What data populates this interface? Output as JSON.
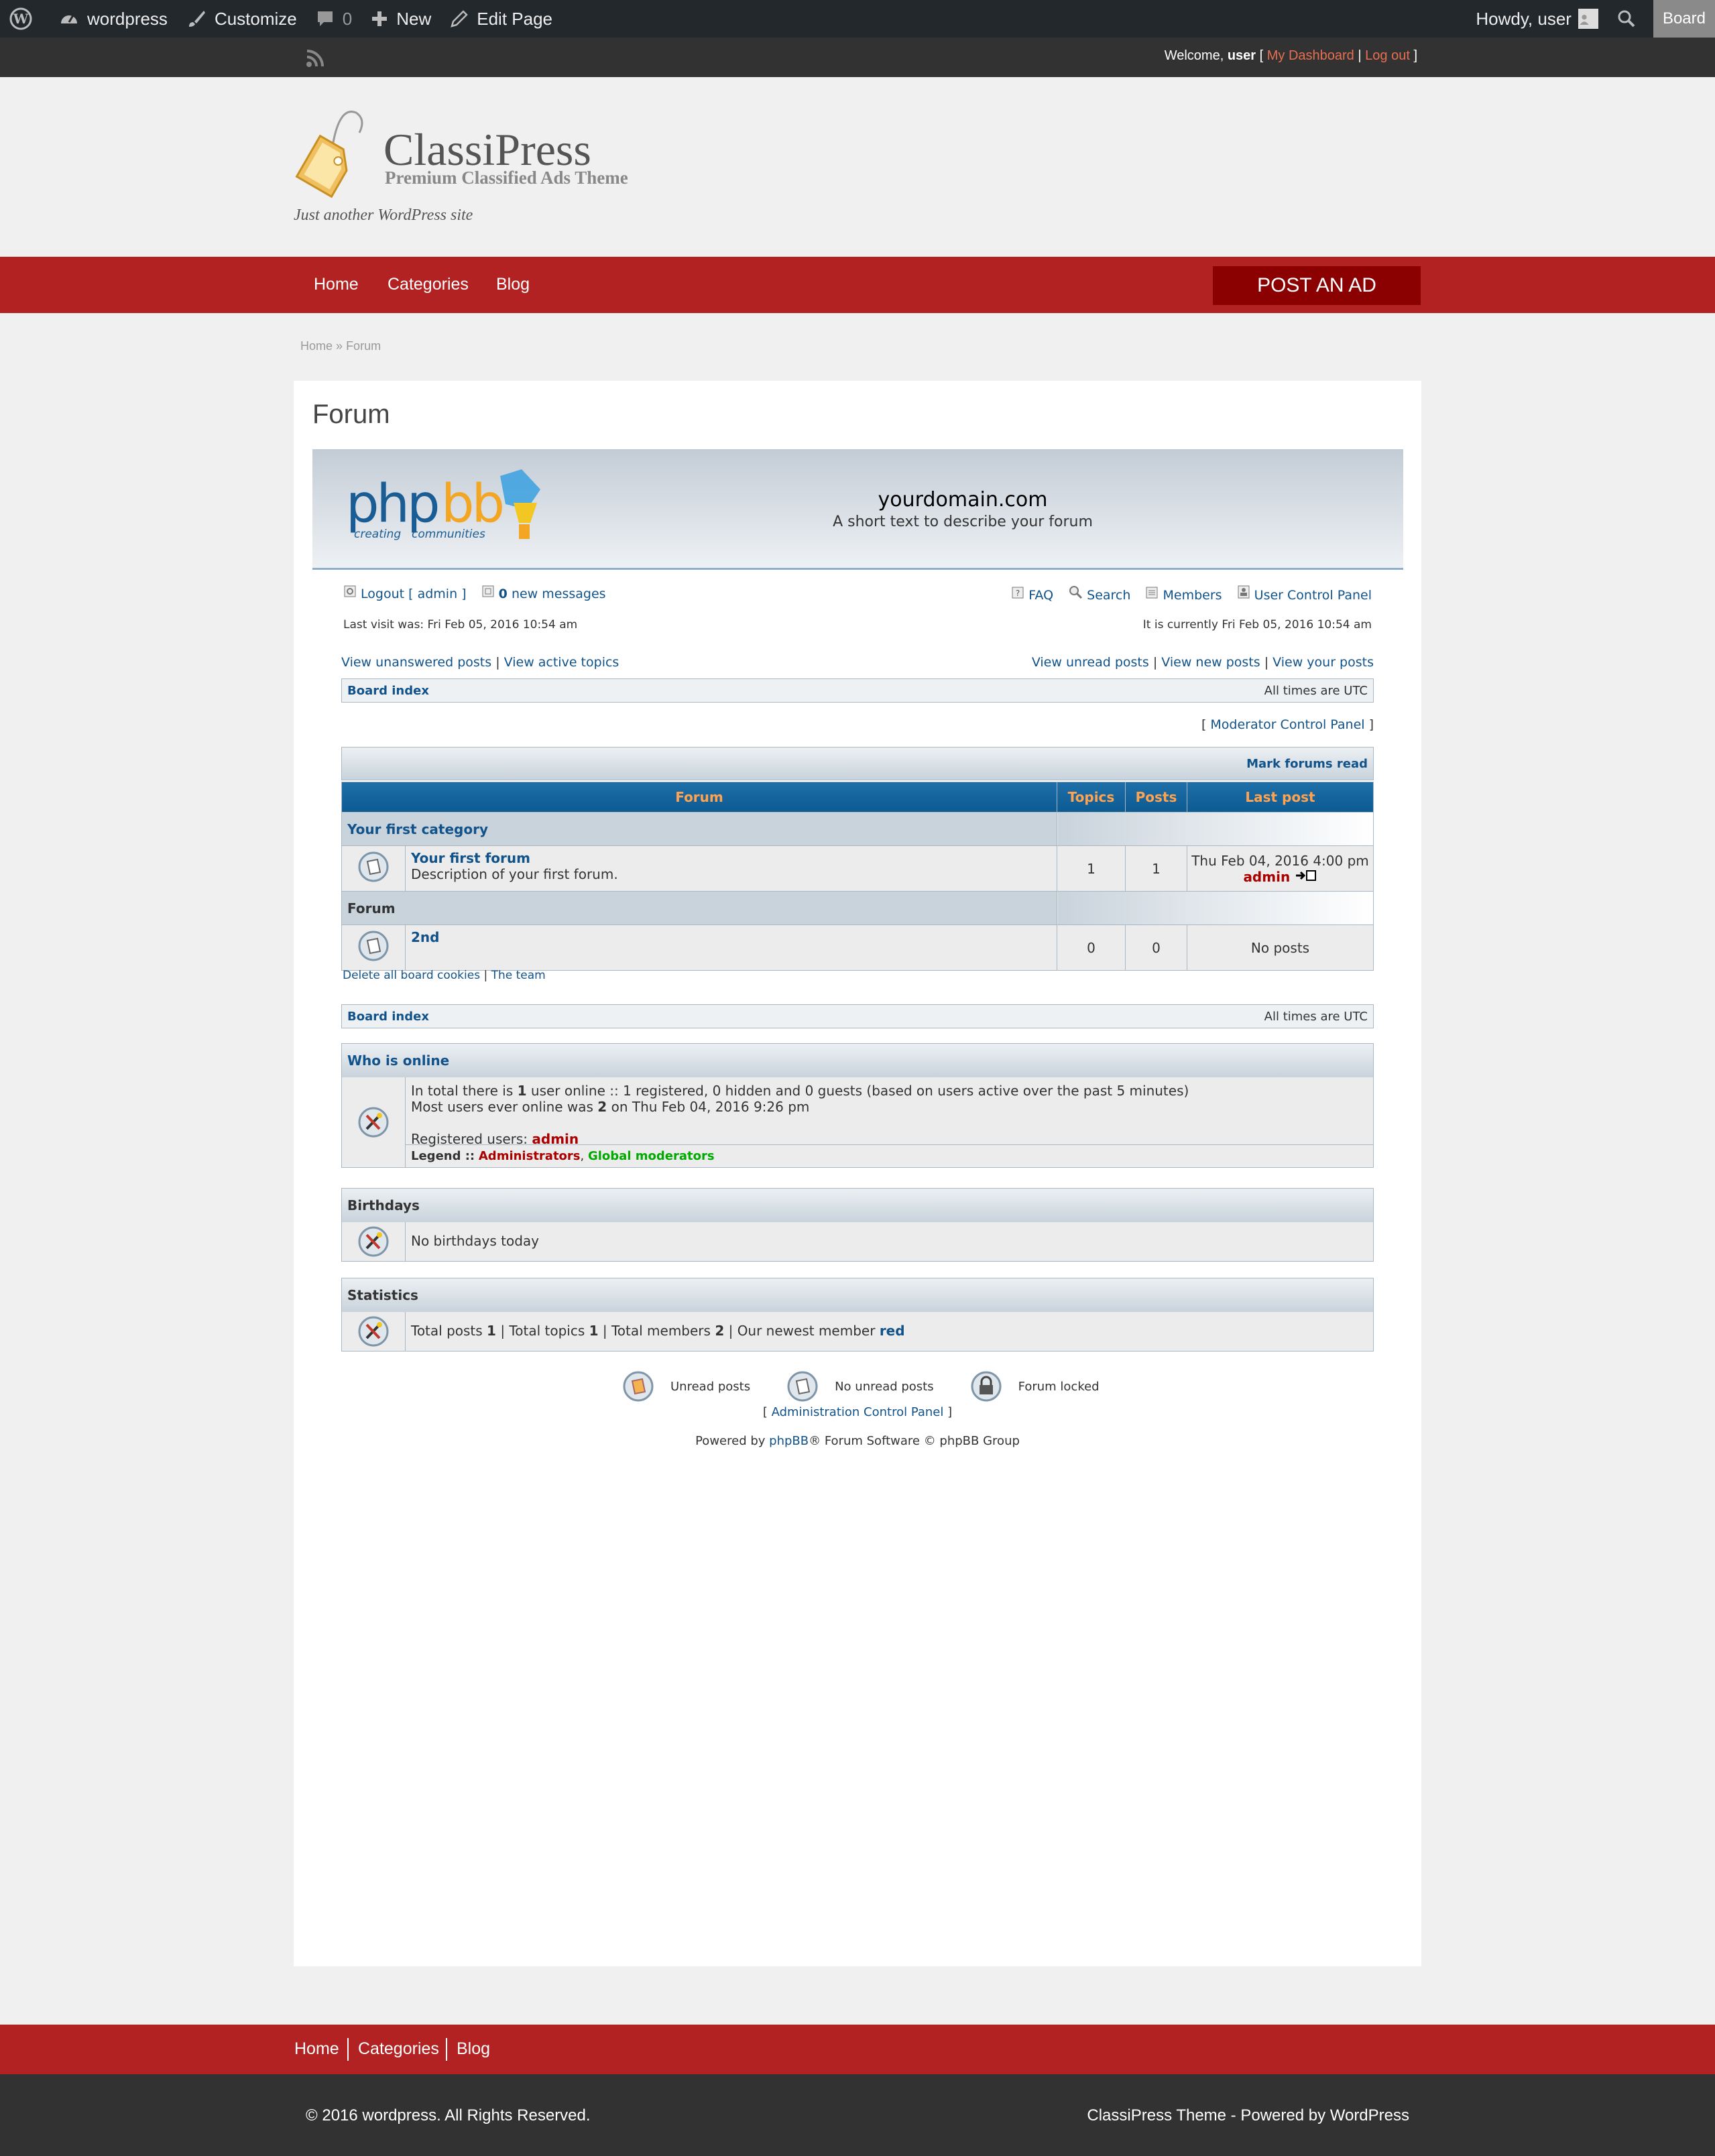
{
  "adminbar": {
    "site": "wordpress",
    "customize": "Customize",
    "comments": "0",
    "new": "New",
    "edit_page": "Edit Page",
    "howdy": "Howdy, user",
    "board": "Board"
  },
  "topbar": {
    "welcome": "Welcome,",
    "user": "user",
    "dashboard": "My Dashboard",
    "logout": "Log out"
  },
  "header": {
    "logo_title": "ClassiPress",
    "logo_sub": "Premium Classified Ads Theme",
    "tagline": "Just another WordPress site"
  },
  "nav": {
    "items": [
      "Home",
      "Categories",
      "Blog"
    ],
    "post_ad": "POST AN AD"
  },
  "breadcrumb": {
    "home": "Home",
    "sep": "»",
    "current": "Forum"
  },
  "page_title": "Forum",
  "forum": {
    "site_name": "yourdomain.com",
    "site_desc": "A short text to describe your forum",
    "logout": "Logout [ admin ]",
    "new_messages_count": "0",
    "new_messages": "new messages",
    "faq": "FAQ",
    "search": "Search",
    "members": "Members",
    "ucp": "User Control Panel",
    "last_visit": "Last visit was: Fri Feb 05, 2016 10:54 am",
    "currently": "It is currently Fri Feb 05, 2016 10:54 am",
    "view_unanswered": "View unanswered posts",
    "view_active": "View active topics",
    "view_unread": "View unread posts",
    "view_new": "View new posts",
    "view_your": "View your posts",
    "board_index": "Board index",
    "all_times": "All times are UTC",
    "mcp": "Moderator Control Panel",
    "mark_read": "Mark forums read",
    "columns": [
      "Forum",
      "Topics",
      "Posts",
      "Last post"
    ],
    "categories": [
      {
        "name": "Your first category",
        "forums": [
          {
            "name": "Your first forum",
            "desc": "Description of your first forum.",
            "topics": "1",
            "posts": "1",
            "last_post": "Thu Feb 04, 2016 4:00 pm",
            "last_author": "admin"
          }
        ]
      },
      {
        "name": "Forum",
        "forums": [
          {
            "name": "2nd",
            "desc": "",
            "topics": "0",
            "posts": "0",
            "last_post": "No posts",
            "last_author": ""
          }
        ]
      }
    ],
    "delete_cookies": "Delete all board cookies",
    "the_team": "The team",
    "who_online": {
      "title": "Who is online",
      "line1_a": "In total there is",
      "line1_count": "1",
      "line1_b": "user online :: 1 registered, 0 hidden and 0 guests (based on users active over the past 5 minutes)",
      "line2_a": "Most users ever online was",
      "line2_count": "2",
      "line2_b": "on Thu Feb 04, 2016 9:26 pm",
      "registered_label": "Registered users:",
      "registered_user": "admin",
      "legend_label": "Legend ::",
      "legend_admin": "Administrators",
      "legend_mod": "Global moderators"
    },
    "birthdays": {
      "title": "Birthdays",
      "text": "No birthdays today"
    },
    "statistics": {
      "title": "Statistics",
      "posts_label": "Total posts",
      "posts": "1",
      "topics_label": "Total topics",
      "topics": "1",
      "members_label": "Total members",
      "members": "2",
      "newest_label": "Our newest member",
      "newest": "red"
    },
    "legend_icons": {
      "unread": "Unread posts",
      "no_unread": "No unread posts",
      "locked": "Forum locked"
    },
    "acp": "Administration Control Panel",
    "powered_a": "Powered by",
    "powered_link": "phpBB",
    "powered_b": "® Forum Software © phpBB Group"
  },
  "footer": {
    "nav": [
      "Home",
      "Categories",
      "Blog"
    ],
    "copyright": "© 2016 wordpress. All Rights Reserved.",
    "powered": "ClassiPress Theme - Powered by WordPress"
  },
  "colors": {
    "nav_red": "#b22222",
    "post_ad": "#8b0000",
    "dark": "#323232",
    "adminbar": "#23282d",
    "phpbb_link": "#105289",
    "table_head": "#0c5a92"
  }
}
